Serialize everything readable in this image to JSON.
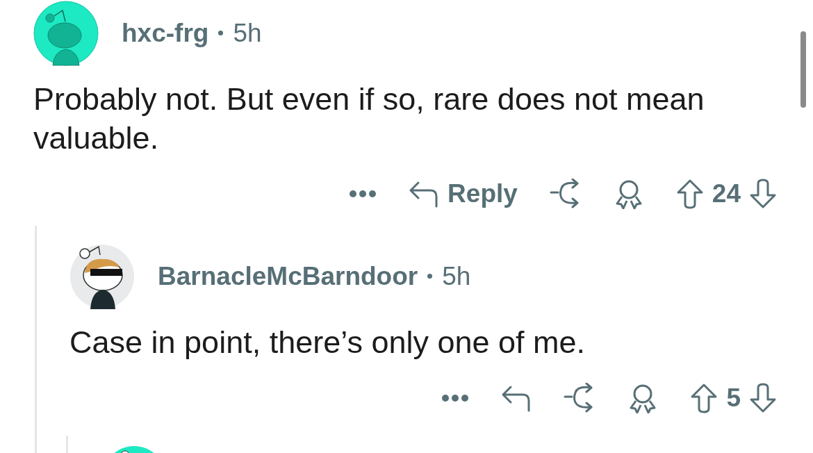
{
  "comments": [
    {
      "username": "hxc-frg",
      "time": "5h",
      "body": "Probably not. But even if so, rare does not mean valuable.",
      "reply_label": "Reply",
      "score": "24",
      "children": [
        {
          "username": "BarnacleMcBarndoor",
          "time": "5h",
          "body": "Case in point, there’s only one of me.",
          "score": "5"
        }
      ]
    }
  ]
}
